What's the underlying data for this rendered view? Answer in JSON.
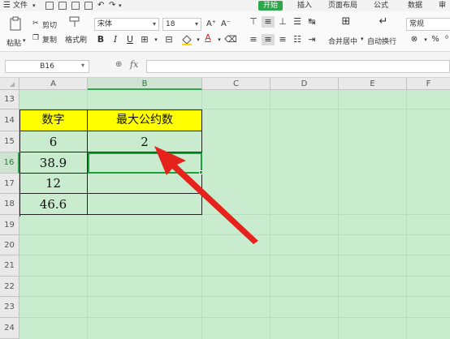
{
  "menubar": {
    "file": "文件",
    "tabs": [
      "开始",
      "插入",
      "页面布局",
      "公式",
      "数据",
      "审"
    ]
  },
  "ribbon": {
    "paste": "粘贴",
    "cut": "剪切",
    "copy": "复制",
    "format_painter": "格式刷",
    "font_name": "宋体",
    "font_size": "18",
    "merge_center": "合并居中",
    "wrap_text": "自动换行",
    "number_format": "常规",
    "bold": "B",
    "italic": "I",
    "underline": "U"
  },
  "formula_bar": {
    "name_box": "B16",
    "fx": "fx",
    "value": ""
  },
  "sheet": {
    "columns": [
      "A",
      "B",
      "C",
      "D",
      "E",
      "F"
    ],
    "rows": [
      "13",
      "14",
      "15",
      "16",
      "17",
      "18",
      "19",
      "20",
      "21",
      "22",
      "23",
      "24"
    ],
    "selected_column": "B",
    "selected_row": "16",
    "table": {
      "header": [
        "数字",
        "最大公约数"
      ],
      "cells": [
        [
          "6",
          "2"
        ],
        [
          "38.9",
          ""
        ],
        [
          "12",
          ""
        ],
        [
          "46.6",
          ""
        ]
      ]
    }
  },
  "colors": {
    "sheet_bg": "#c9eccf",
    "header_fill": "#ffff00",
    "accent": "#2fa64c",
    "annotation_arrow": "#e5231c"
  }
}
